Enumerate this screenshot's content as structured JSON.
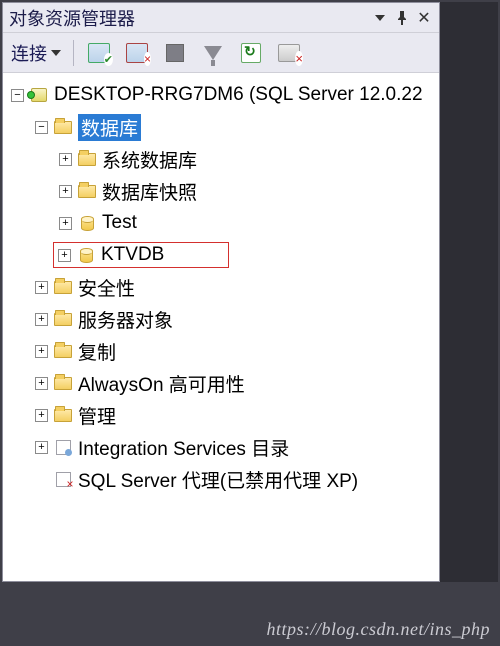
{
  "window": {
    "title": "对象资源管理器"
  },
  "toolbar": {
    "connect_label": "连接"
  },
  "tree": {
    "server": {
      "label": "DESKTOP-RRG7DM6 (SQL Server 12.0.22"
    },
    "databases": {
      "label": "数据库",
      "children": {
        "system_dbs": "系统数据库",
        "snapshots": "数据库快照",
        "test": "Test",
        "ktvdb": "KTVDB"
      }
    },
    "security": "安全性",
    "server_objects": "服务器对象",
    "replication": "复制",
    "alwayson": "AlwaysOn 高可用性",
    "management": "管理",
    "ssis": "Integration Services 目录",
    "agent": "SQL Server 代理(已禁用代理 XP)"
  },
  "watermark": "https://blog.csdn.net/ins_php"
}
